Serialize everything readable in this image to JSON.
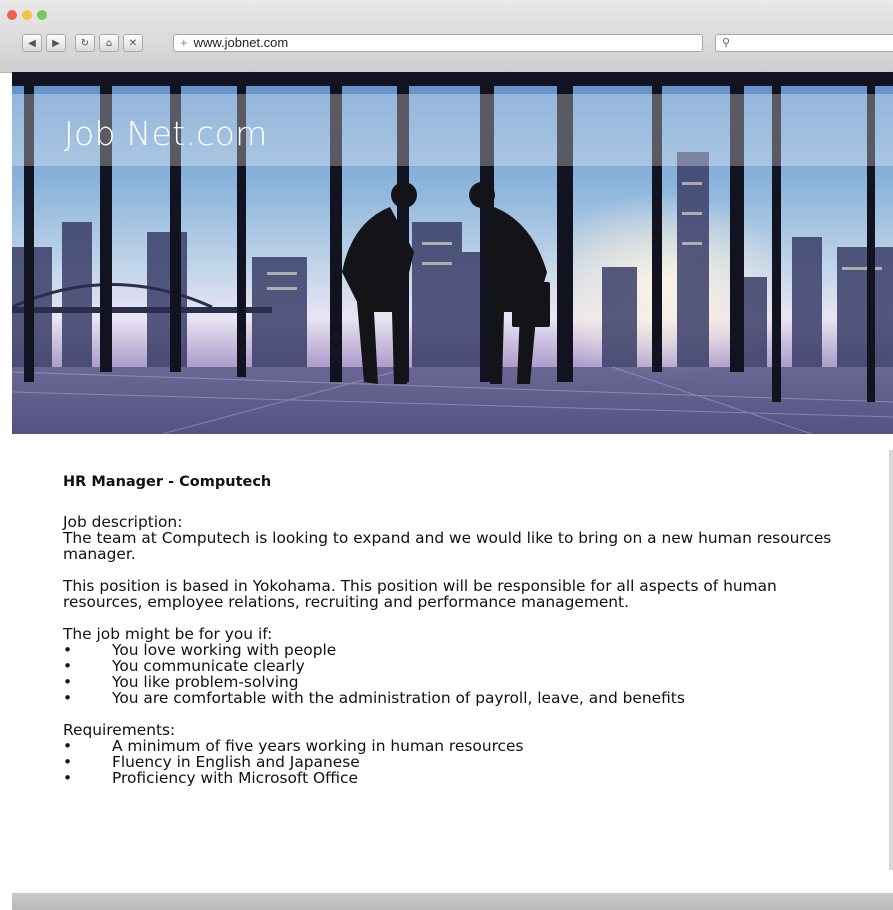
{
  "browser": {
    "url": "www.jobnet.com",
    "nav_icons": [
      "back-icon",
      "forward-icon",
      "reload-icon",
      "home-icon",
      "stop-icon"
    ],
    "search_icon": "search-icon"
  },
  "site": {
    "logo": "Job Net.com"
  },
  "job": {
    "title": "HR Manager - Computech",
    "desc_label": "Job description:",
    "desc_1": "The team at Computech is looking to expand and we would like to bring on a new human resources manager.",
    "desc_2": "This position is based in Yokohama. This position will be responsible for all aspects of human resources, employee relations, recruiting and performance management.",
    "fit_label": "The job might be for you if:",
    "fit_items": [
      "You love working with people",
      "You communicate clearly",
      "You like problem-solving",
      "You are comfortable with the administration of payroll, leave, and benefits"
    ],
    "req_label": "Requirements:",
    "req_items": [
      "A minimum of five years working in human resources",
      "Fluency in English and Japanese",
      "Proficiency with Microsoft Office"
    ]
  }
}
